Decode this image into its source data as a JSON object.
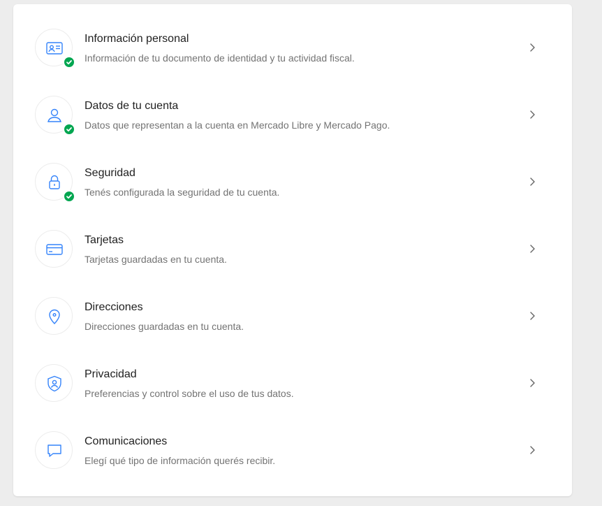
{
  "colors": {
    "accent": "#3483fa",
    "success": "#00a650",
    "title": "#1f1f1f",
    "description": "#737373",
    "background": "#ededed"
  },
  "items": [
    {
      "title": "Información personal",
      "description": "Información de tu documento de identidad y tu actividad fiscal.",
      "icon": "id-card-icon",
      "verified": true
    },
    {
      "title": "Datos de tu cuenta",
      "description": "Datos que representan a la cuenta en Mercado Libre y Mercado Pago.",
      "icon": "user-icon",
      "verified": true
    },
    {
      "title": "Seguridad",
      "description": "Tenés configurada la seguridad de tu cuenta.",
      "icon": "lock-icon",
      "verified": true
    },
    {
      "title": "Tarjetas",
      "description": "Tarjetas guardadas en tu cuenta.",
      "icon": "credit-card-icon",
      "verified": false
    },
    {
      "title": "Direcciones",
      "description": "Direcciones guardadas en tu cuenta.",
      "icon": "location-pin-icon",
      "verified": false
    },
    {
      "title": "Privacidad",
      "description": "Preferencias y control sobre el uso de tus datos.",
      "icon": "shield-user-icon",
      "verified": false
    },
    {
      "title": "Comunicaciones",
      "description": "Elegí qué tipo de información querés recibir.",
      "icon": "chat-bubble-icon",
      "verified": false
    }
  ]
}
